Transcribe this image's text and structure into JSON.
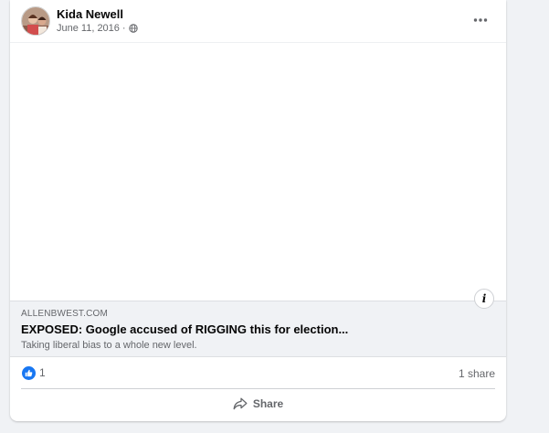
{
  "post": {
    "author": "Kida Newell",
    "date": "June 11, 2016",
    "separator": "·",
    "audience_icon": "globe-icon",
    "more_icon": "more-options-icon"
  },
  "link_preview": {
    "domain": "ALLENBWEST.COM",
    "title": "EXPOSED: Google accused of RIGGING this for election...",
    "description": "Taking liberal bias to a whole new level.",
    "info_icon": "info-icon",
    "info_glyph": "i"
  },
  "stats": {
    "likes": "1",
    "shares": "1 share",
    "reaction_icon": "like-reaction-icon"
  },
  "actions": {
    "share_label": "Share",
    "share_icon": "share-arrow-icon"
  },
  "colors": {
    "brand_blue": "#1877f2",
    "page_bg": "#f0f2f5",
    "secondary_text": "#65676b"
  }
}
